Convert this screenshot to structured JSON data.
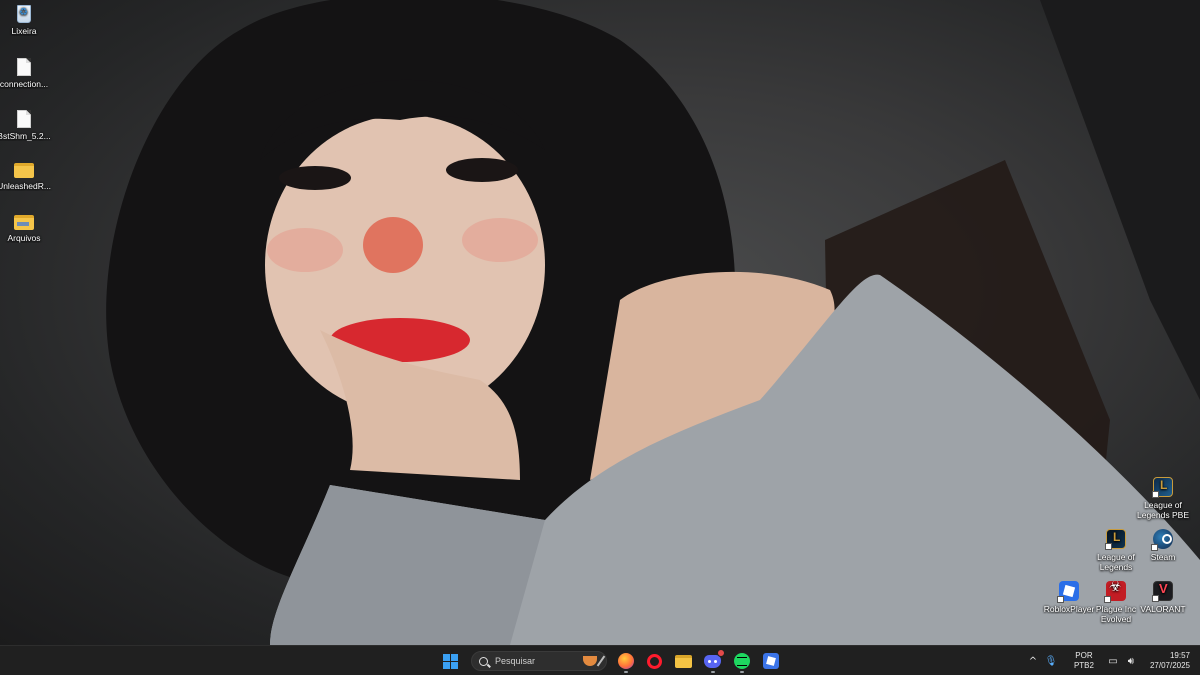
{
  "desktop": {
    "left_icons": [
      {
        "label": "Lixeira",
        "icon": "recycle-bin-icon"
      },
      {
        "label": "connection...",
        "icon": "text-file-icon"
      },
      {
        "label": "BstShm_5.2...",
        "icon": "text-file-icon"
      },
      {
        "label": "UnleashedR...",
        "icon": "folder-icon"
      },
      {
        "label": "Arquivos",
        "icon": "zip-folder-icon"
      }
    ],
    "right_icons": [
      {
        "label": "League of Legends PBE",
        "icon": "league-of-legends-pbe-icon"
      },
      {
        "label": "League of Legends",
        "icon": "league-of-legends-icon"
      },
      {
        "label": "Steam",
        "icon": "steam-icon"
      },
      {
        "label": "RobloxPlayer",
        "icon": "roblox-icon"
      },
      {
        "label": "Plague Inc Evolved",
        "icon": "plague-inc-icon"
      },
      {
        "label": "VALORANT",
        "icon": "valorant-icon"
      }
    ]
  },
  "taskbar": {
    "start_icon": "windows-logo-icon",
    "search": {
      "placeholder": "Pesquisar"
    },
    "pinned_apps": [
      {
        "name": "Firefox",
        "icon": "firefox-icon",
        "active": true
      },
      {
        "name": "Opera",
        "icon": "opera-icon",
        "active": false
      },
      {
        "name": "File Explorer",
        "icon": "folder-icon",
        "active": false
      },
      {
        "name": "Discord",
        "icon": "discord-icon",
        "active": true,
        "has_badge": true
      },
      {
        "name": "Spotify",
        "icon": "spotify-icon",
        "active": true
      },
      {
        "name": "Roblox",
        "icon": "roblox-icon",
        "active": false
      }
    ],
    "tray": {
      "chevron": "^",
      "language_line1": "POR",
      "language_line2": "PTB2",
      "time": "19:57",
      "date": "27/07/2025"
    }
  },
  "colors": {
    "taskbar_bg": "#202020",
    "accent": "#3aa0f3"
  }
}
